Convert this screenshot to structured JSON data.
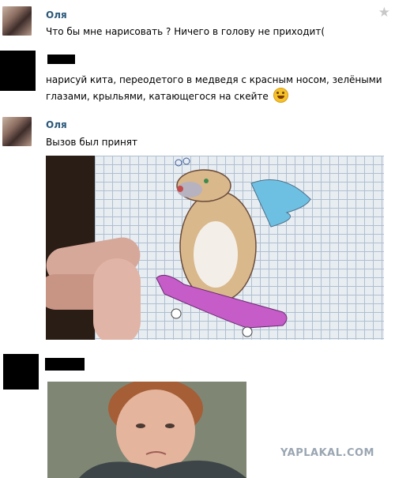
{
  "messages": [
    {
      "author": "Оля",
      "lines": [
        "Что бы мне нарисовать ? Ничего в голову не приходит("
      ]
    },
    {
      "author": "",
      "lines": [
        "нарисуй кита, переодетого в медведя с красным носом, зелёными",
        "глазами, крыльями, катающегося на скейте"
      ]
    },
    {
      "author": "Оля",
      "lines": [
        "Вызов был принят"
      ]
    },
    {
      "author": "",
      "lines": []
    }
  ],
  "icons": {
    "star": "star-icon",
    "emoji": "smiley-emoji-icon"
  },
  "colors": {
    "author_name": "#2b587a",
    "star": "#c8c8c8",
    "watermark": "#9aa6b2"
  },
  "watermark": "YAPLAKAL.COM"
}
